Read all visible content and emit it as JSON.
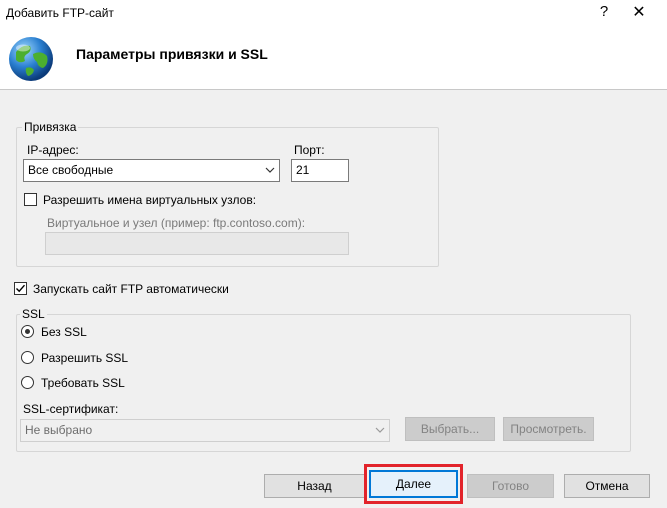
{
  "window": {
    "title": "Добавить FTP-сайт",
    "help_glyph": "?",
    "close_glyph": "✕"
  },
  "header": {
    "title": "Параметры привязки и SSL",
    "icon": "globe-icon"
  },
  "binding": {
    "group_label": "Привязка",
    "ip_label": "IP-адрес:",
    "ip_value": "Все свободные",
    "port_label": "Порт:",
    "port_value": "21",
    "virtual_hosts_label": "Разрешить имена виртуальных узлов:",
    "virtual_hosts_checked": false,
    "virtual_host_label": "Виртуальное и узел (пример: ftp.contoso.com):",
    "virtual_host_value": ""
  },
  "autostart": {
    "label": "Запускать сайт FTP автоматически",
    "checked": true
  },
  "ssl": {
    "group_label": "SSL",
    "options": [
      "Без SSL",
      "Разрешить SSL",
      "Требовать SSL"
    ],
    "selected": "Без SSL",
    "cert_label": "SSL-сертификат:",
    "cert_value": "Не выбрано",
    "select_button": "Выбрать...",
    "view_button": "Просмотреть."
  },
  "footer": {
    "back": "Назад",
    "next": "Далее",
    "finish": "Готово",
    "cancel": "Отмена"
  },
  "colors": {
    "accent": "#0078d7",
    "highlight": "#e2232a"
  }
}
